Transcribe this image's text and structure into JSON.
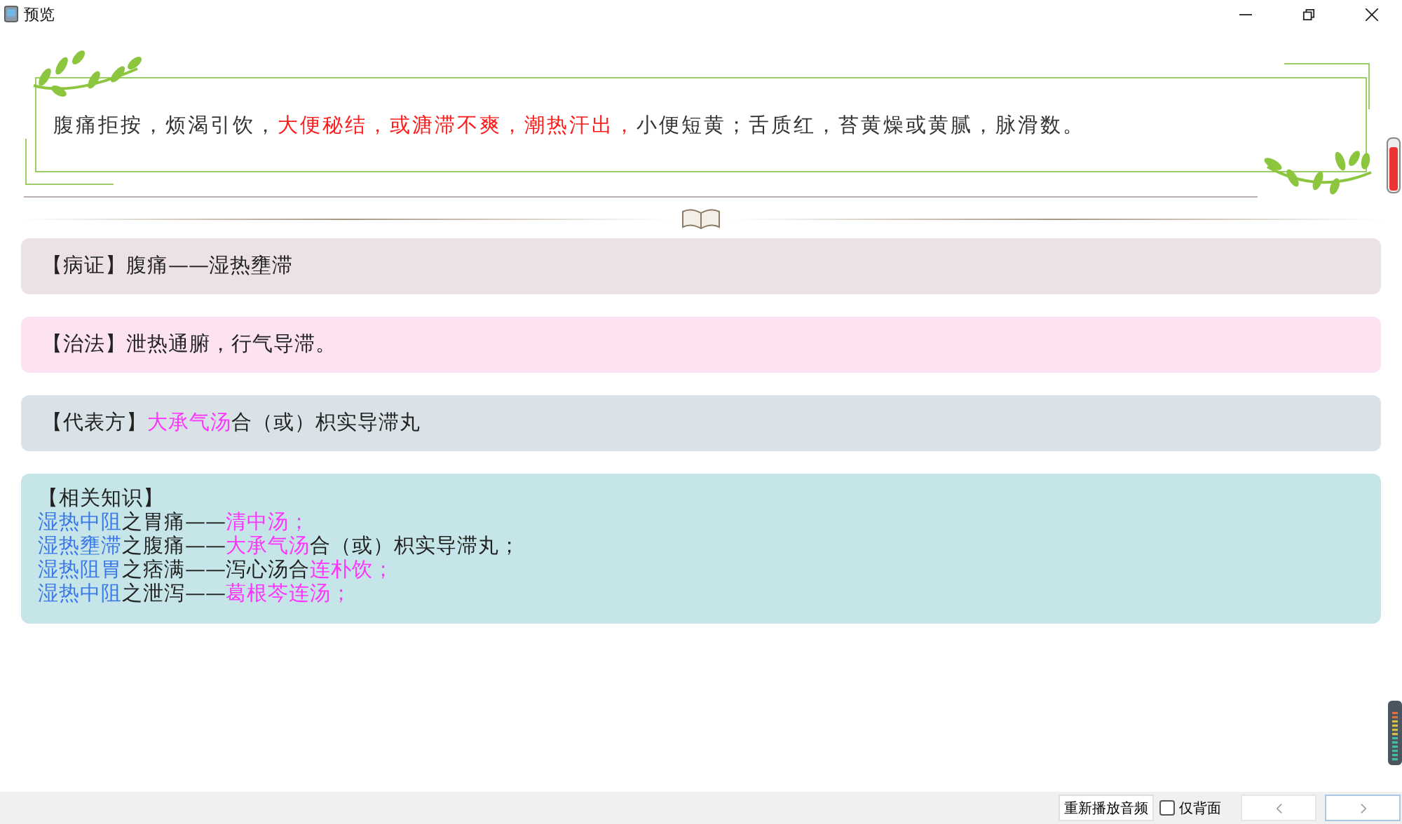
{
  "window": {
    "title": "预览"
  },
  "question": {
    "segments": [
      {
        "text": "腹痛拒按，烦渴引饮，",
        "color": "#333333"
      },
      {
        "text": "大便秘结，或溏滞不爽，潮热汗出，",
        "color": "#ff1a1a"
      },
      {
        "text": "小便短黄；舌质红，苔黄燥或黄腻，脉滑数。",
        "color": "#333333"
      }
    ]
  },
  "cards": [
    {
      "color": "#ece1e5",
      "lines": [
        [
          {
            "text": "【病证】腹痛——湿热壅滞",
            "color": "#222222"
          }
        ]
      ]
    },
    {
      "color": "#fde2f1",
      "lines": [
        [
          {
            "text": "【治法】泄热通腑，行气导滞。",
            "color": "#222222"
          }
        ]
      ]
    },
    {
      "color": "#d9e2e6",
      "lines": [
        [
          {
            "text": "【代表方】",
            "color": "#222222"
          },
          {
            "text": "大承气汤",
            "color": "#ff33ff"
          },
          {
            "text": "合（或）枳实导滞丸",
            "color": "#222222"
          }
        ]
      ]
    },
    {
      "color": "#c6e5e8",
      "lines": [
        [
          {
            "text": "【相关知识】",
            "color": "#222222"
          }
        ],
        [
          {
            "text": "湿热中阻",
            "color": "#3b78e7"
          },
          {
            "text": "之胃痛——",
            "color": "#222222"
          },
          {
            "text": "清中汤；",
            "color": "#ff33ff"
          }
        ],
        [
          {
            "text": "湿热壅滞",
            "color": "#3b78e7"
          },
          {
            "text": "之腹痛——",
            "color": "#222222"
          },
          {
            "text": "大承气汤",
            "color": "#ff33ff"
          },
          {
            "text": "合（或）枳实导滞丸；",
            "color": "#222222"
          }
        ],
        [
          {
            "text": "湿热阻胃",
            "color": "#3b78e7"
          },
          {
            "text": "之痞满——泻心汤合",
            "color": "#222222"
          },
          {
            "text": "连朴饮；",
            "color": "#ff33ff"
          }
        ],
        [
          {
            "text": "湿热中阻",
            "color": "#3b78e7"
          },
          {
            "text": "之泄泻——",
            "color": "#222222"
          },
          {
            "text": "葛根芩连汤；",
            "color": "#ff33ff"
          }
        ]
      ]
    }
  ],
  "footer": {
    "replay_button": "重新播放音频",
    "back_only": {
      "label": "仅背面",
      "checked": false
    }
  }
}
